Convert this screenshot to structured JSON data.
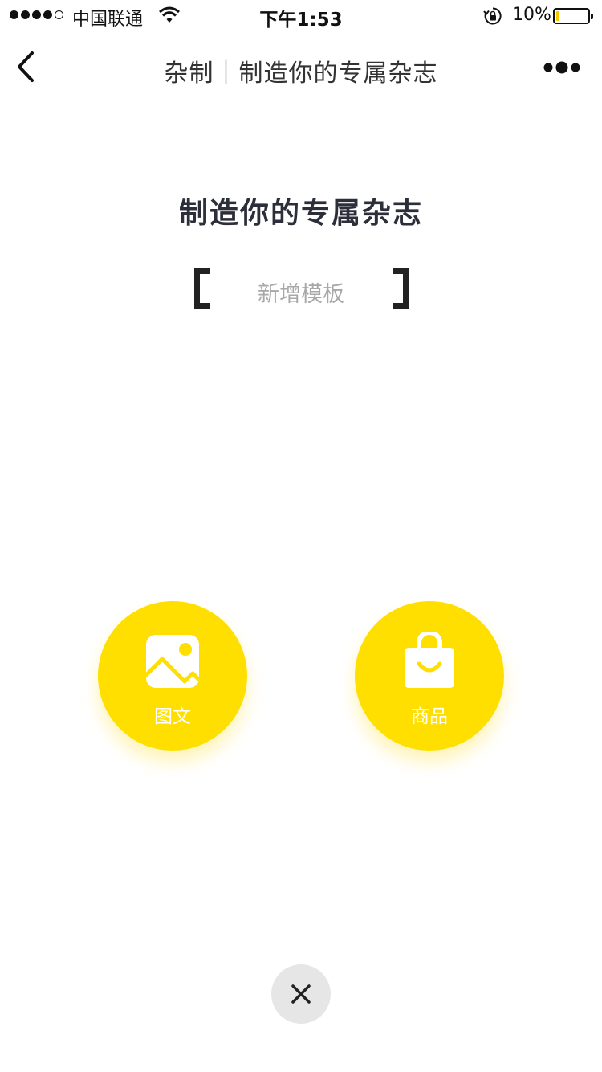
{
  "status_bar": {
    "carrier": "中国联通",
    "time": "下午1:53",
    "battery_percent": "10%",
    "battery_level": 0.1,
    "signal_bars": 4,
    "signal_total": 5
  },
  "nav": {
    "title": "杂制｜制造你的专属杂志"
  },
  "main": {
    "title": "制造你的专属杂志",
    "template_label": "新增模板"
  },
  "actions": [
    {
      "label": "图文",
      "icon": "image-icon"
    },
    {
      "label": "商品",
      "icon": "shopping-bag-icon"
    }
  ],
  "colors": {
    "accent": "#ffdf00",
    "close_bg": "#e6e6e6",
    "title": "#2c2f3a",
    "placeholder": "#a8a8a8"
  }
}
